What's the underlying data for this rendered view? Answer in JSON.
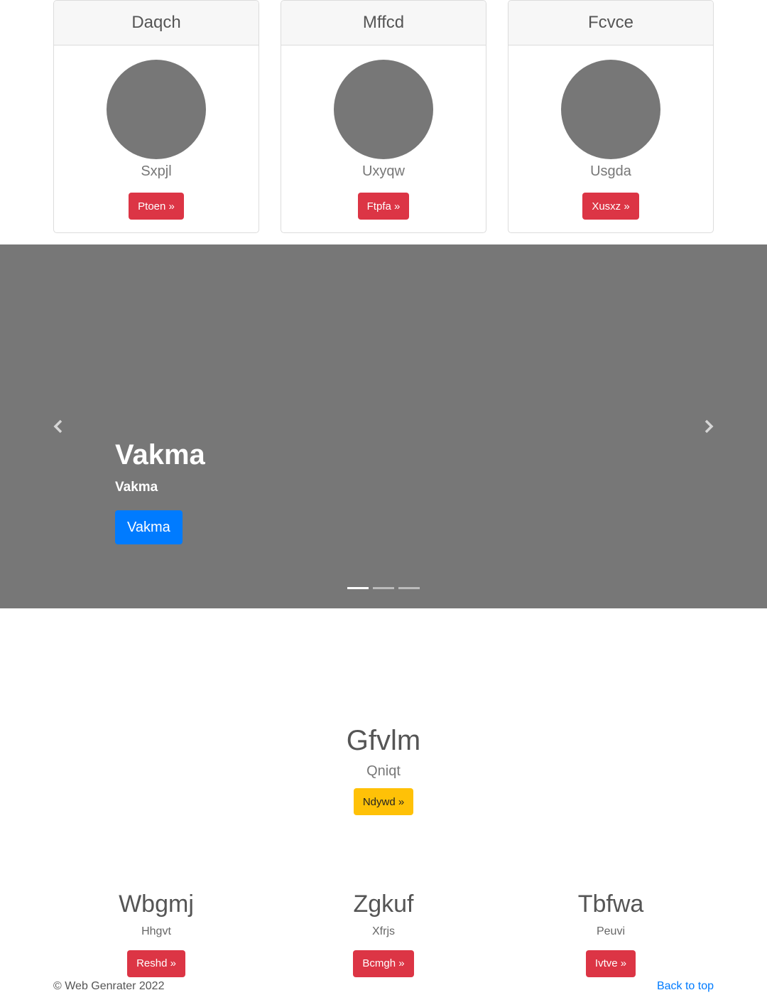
{
  "cards": [
    {
      "title": "Daqch",
      "subtitle": "Sxpjl",
      "button": "Ptoen »"
    },
    {
      "title": "Mffcd",
      "subtitle": "Uxyqw",
      "button": "Ftpfa »"
    },
    {
      "title": "Fcvce",
      "subtitle": "Usgda",
      "button": "Xusxz »"
    }
  ],
  "carousel": {
    "prev_icon": "chevron-left-icon",
    "next_icon": "chevron-right-icon",
    "title": "Vakma",
    "text": "Vakma",
    "button": "Vakma",
    "slide_count": 3,
    "active_index": 0
  },
  "featured": {
    "title": "Gfvlm",
    "subtitle": "Qniqt",
    "button": "Ndywd »"
  },
  "columns": [
    {
      "title": "Wbgmj",
      "subtitle": "Hhgvt",
      "button": "Reshd »"
    },
    {
      "title": "Zgkuf",
      "subtitle": "Xfrjs",
      "button": "Bcmgh »"
    },
    {
      "title": "Tbfwa",
      "subtitle": "Peuvi",
      "button": "Ivtve »"
    }
  ],
  "footer": {
    "copyright": "© Web Genrater 2022",
    "back_to_top": "Back to top"
  },
  "colors": {
    "danger": "#dc3545",
    "primary": "#007bff",
    "warning": "#ffc107",
    "placeholder_gray": "#777777"
  }
}
